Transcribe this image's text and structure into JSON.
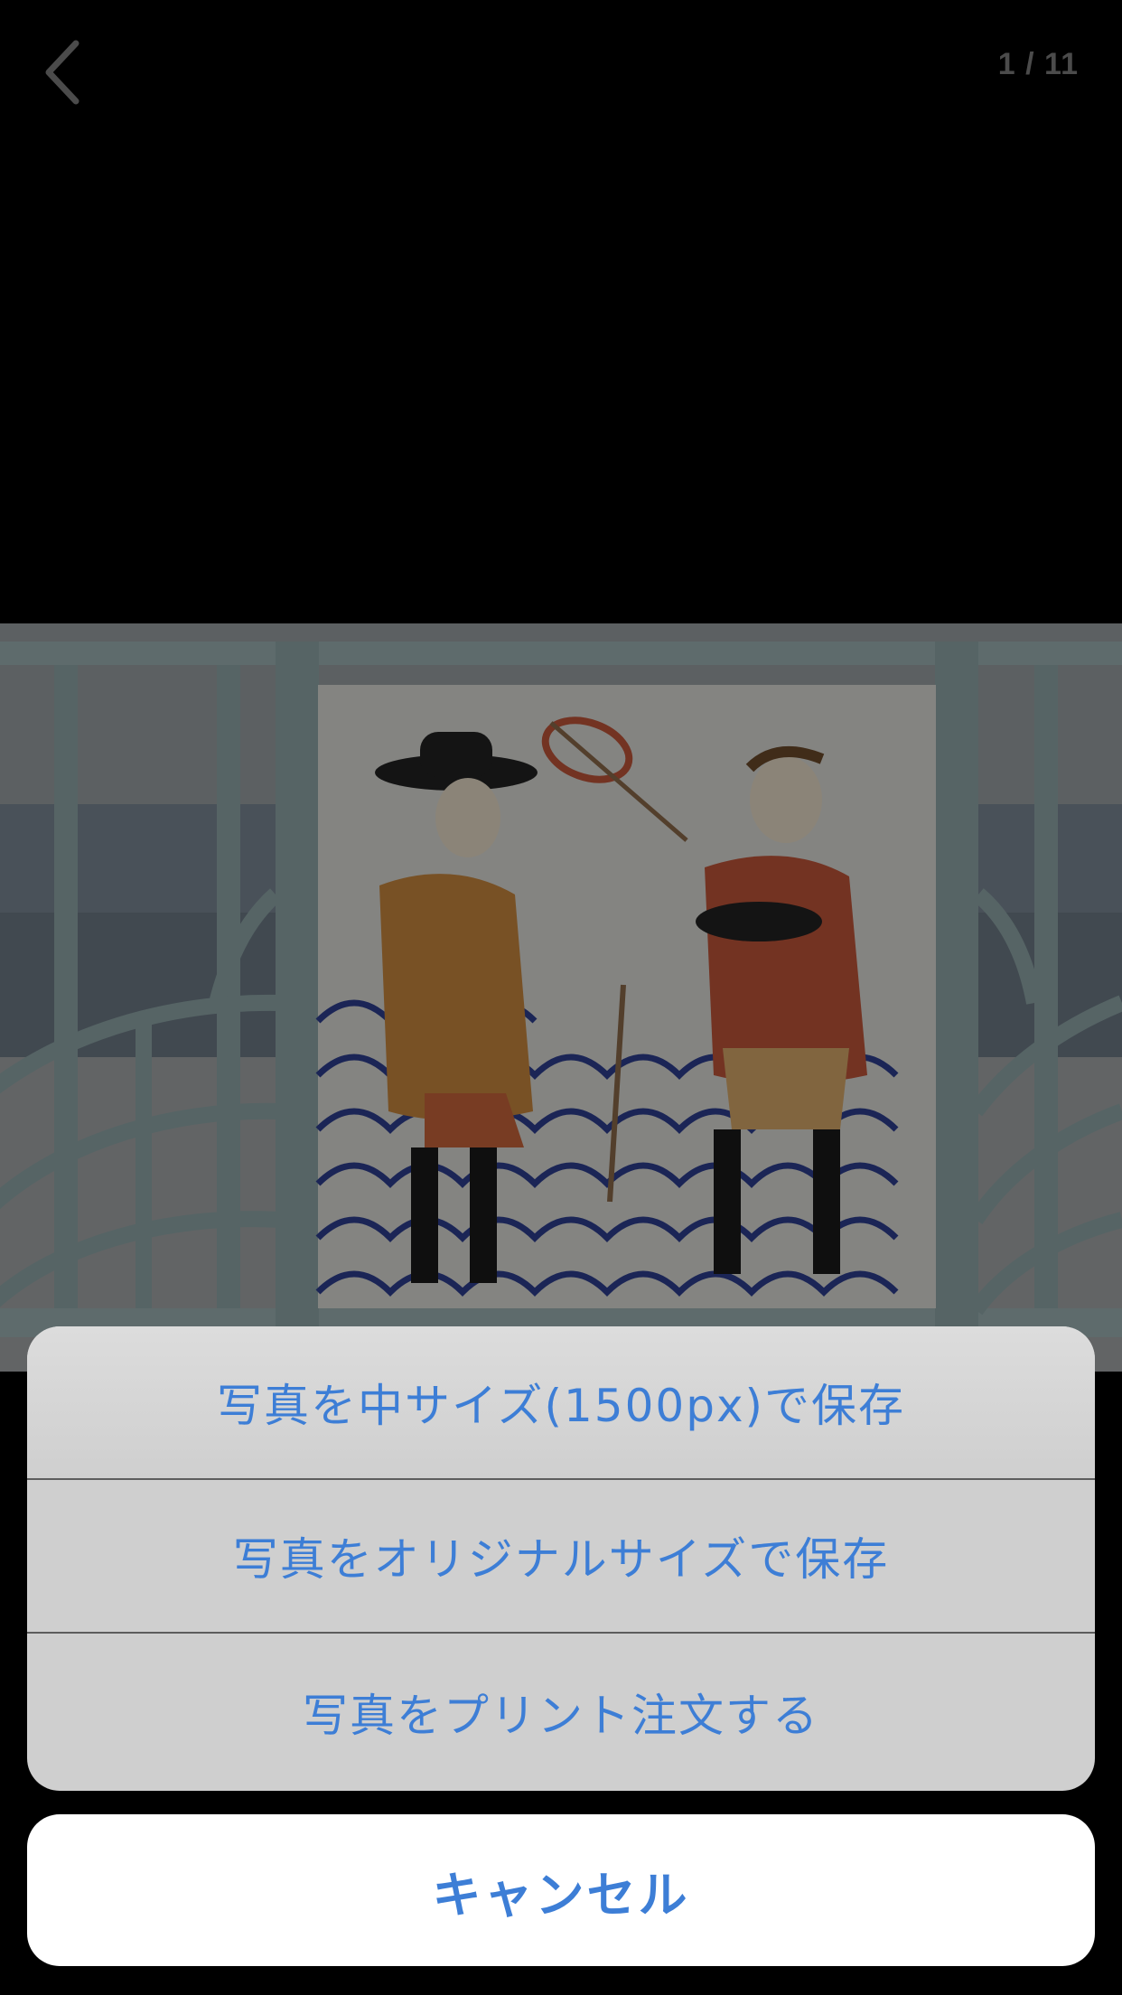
{
  "header": {
    "back_icon": "chevron-left-icon",
    "page_counter": "1 / 11"
  },
  "photo": {
    "subject": "decorative tile with two European figures on blue wave pattern, set in railing"
  },
  "action_sheet": {
    "items": [
      {
        "label": "写真を中サイズ(1500px)で保存"
      },
      {
        "label": "写真をオリジナルサイズで保存"
      },
      {
        "label": "写真をプリント注文する"
      }
    ],
    "cancel_label": "キャンセル"
  },
  "colors": {
    "accent": "#3d7ed6",
    "sheet_background": "#cfcfcf",
    "cancel_background": "#ffffff",
    "screen_background": "#000000"
  }
}
